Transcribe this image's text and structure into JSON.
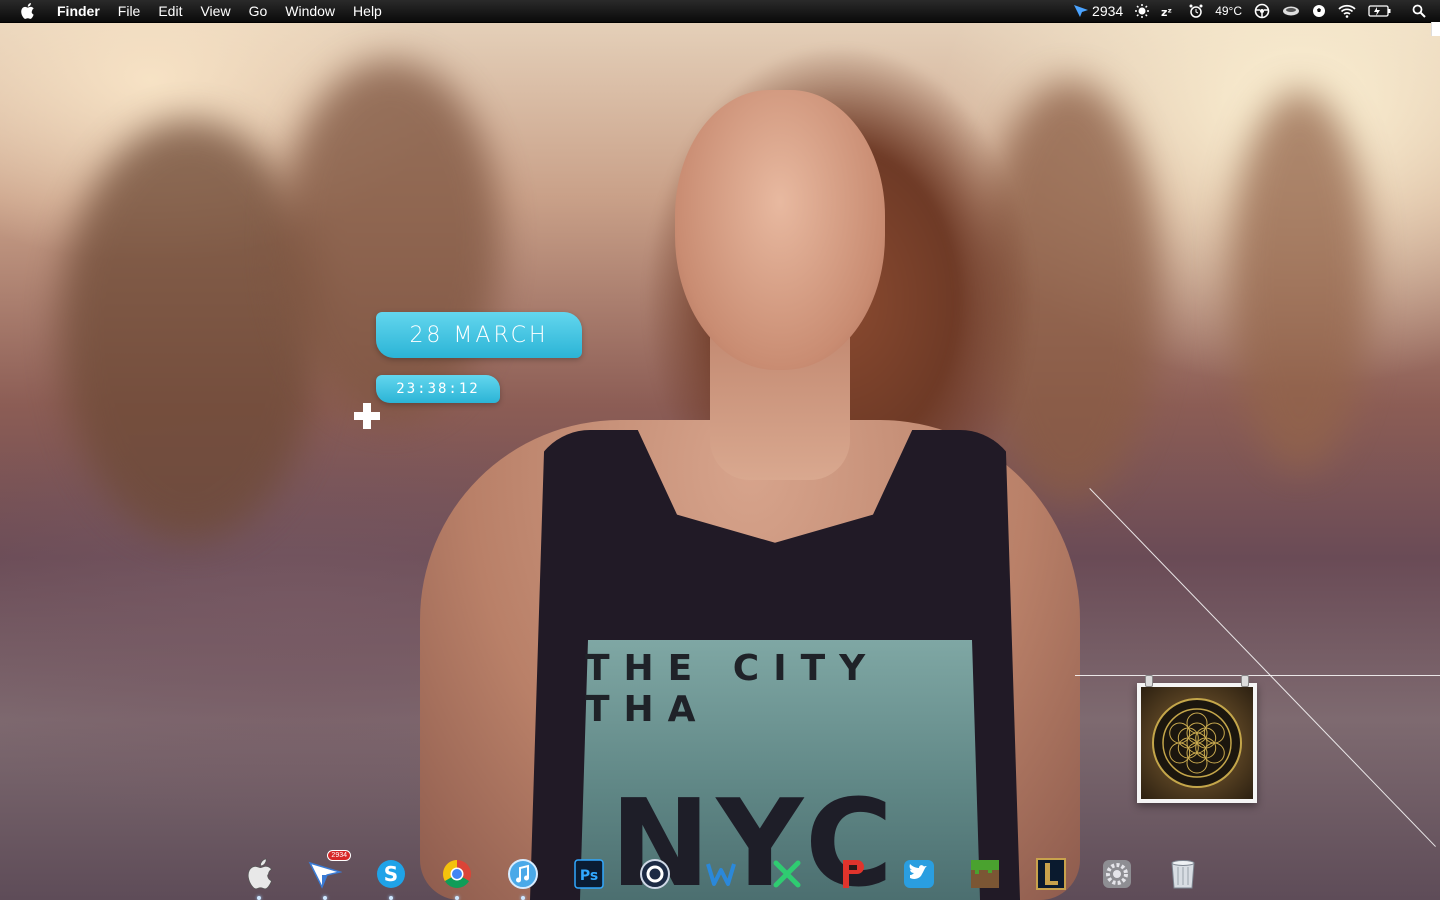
{
  "menubar": {
    "app_name": "Finder",
    "menus": [
      "File",
      "Edit",
      "View",
      "Go",
      "Window",
      "Help"
    ],
    "status": {
      "mail_count": "2934",
      "temperature": "49°C"
    }
  },
  "widgets": {
    "date": "28 MARCH",
    "time": "23:38:12"
  },
  "wallpaper": {
    "shirt_text": "THE CITY THA",
    "shirt_big_text": "NYC"
  },
  "dock": {
    "badge": "2934",
    "items": [
      {
        "name": "finder",
        "running": true
      },
      {
        "name": "sparrow-mail",
        "running": true
      },
      {
        "name": "skype",
        "running": true
      },
      {
        "name": "chrome",
        "running": true
      },
      {
        "name": "itunes",
        "running": true
      },
      {
        "name": "photoshop",
        "running": false
      },
      {
        "name": "cinema4d",
        "running": false
      },
      {
        "name": "wunderlist",
        "running": false
      },
      {
        "name": "xmind",
        "running": false
      },
      {
        "name": "pocket",
        "running": false
      },
      {
        "name": "twitter",
        "running": false
      },
      {
        "name": "minecraft",
        "running": false
      },
      {
        "name": "league-of-legends",
        "running": false
      },
      {
        "name": "system-preferences",
        "running": false
      },
      {
        "name": "trash",
        "running": false
      }
    ]
  },
  "colors": {
    "widget_accent": "#2bb4d6",
    "menubar": "#111111"
  }
}
